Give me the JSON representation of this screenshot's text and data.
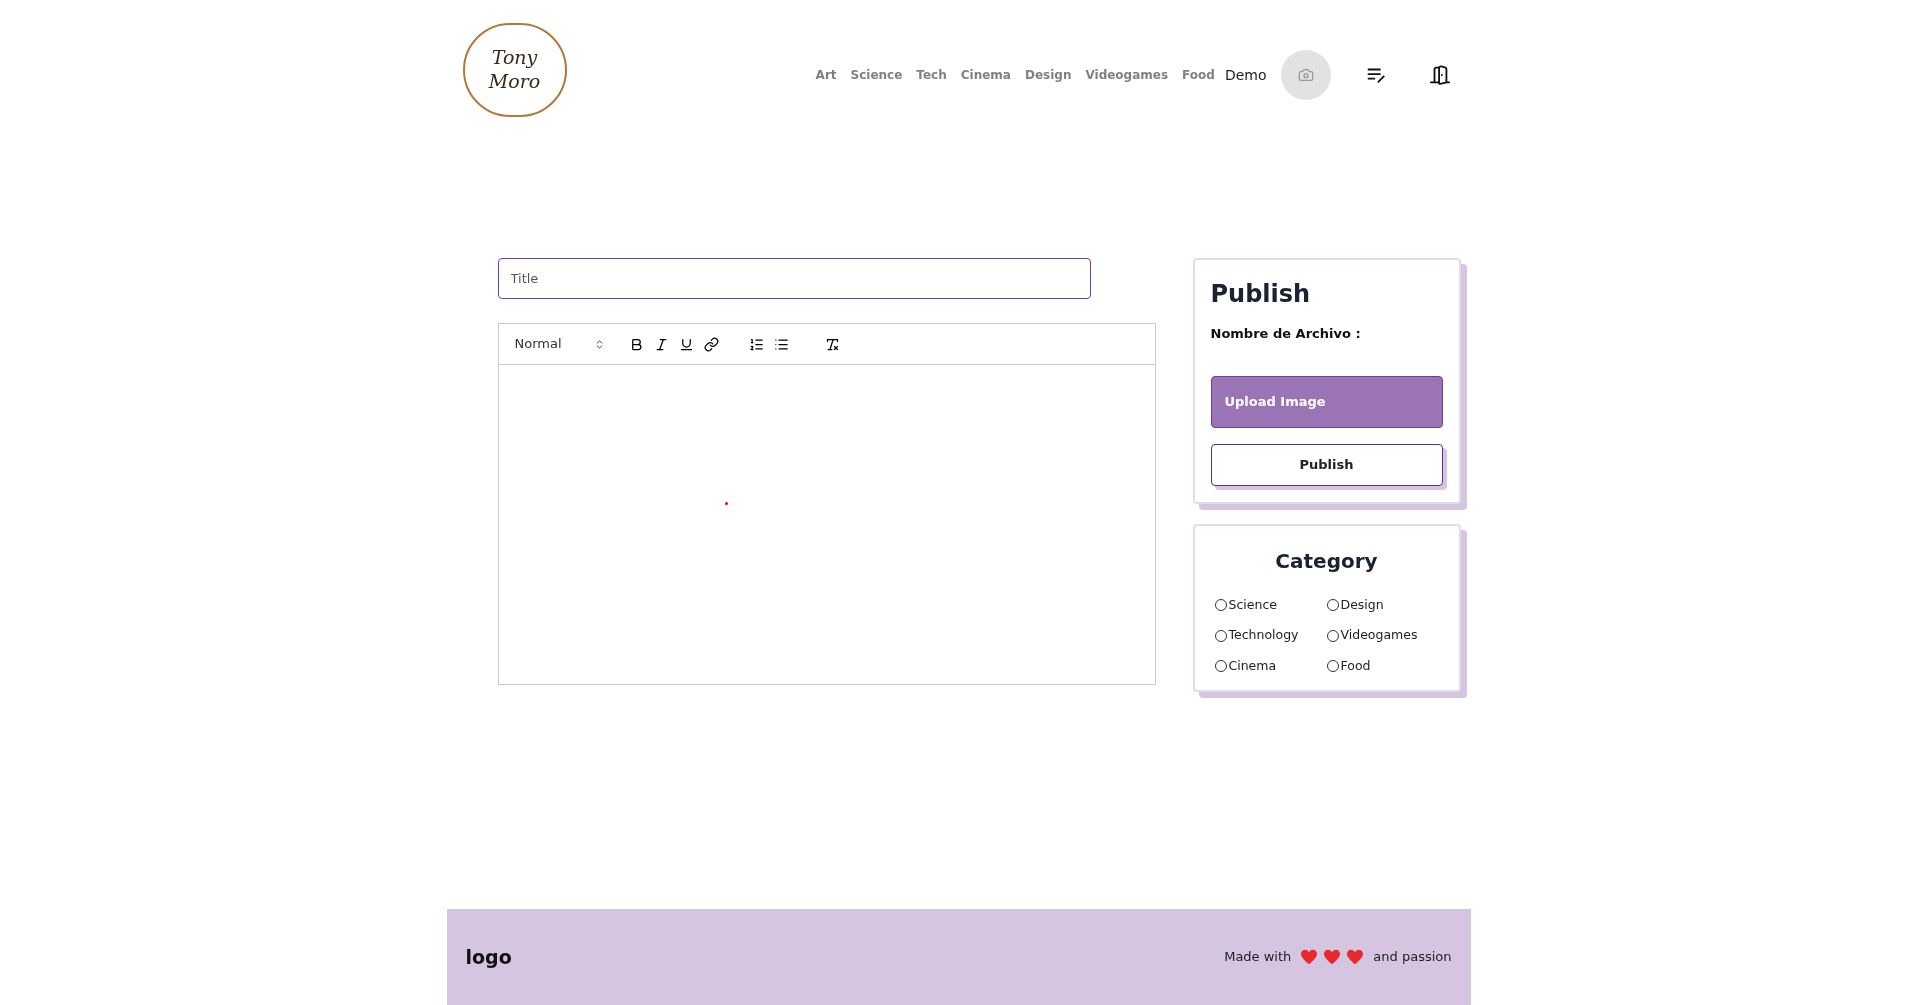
{
  "header": {
    "logo": "Tony Moro",
    "nav": [
      {
        "label": "Art"
      },
      {
        "label": "Science"
      },
      {
        "label": "Tech"
      },
      {
        "label": "Cinema"
      },
      {
        "label": "Design"
      },
      {
        "label": "Videogames"
      },
      {
        "label": "Food"
      }
    ],
    "user": "Demo"
  },
  "editor": {
    "title_placeholder": "Title",
    "format": "Normal"
  },
  "publish": {
    "heading": "Publish",
    "file_label": "Nombre de Archivo :",
    "upload_button": "Upload Image",
    "publish_button": "Publish"
  },
  "category": {
    "heading": "Category",
    "options": [
      {
        "label": "Science",
        "selected": false
      },
      {
        "label": "Design",
        "selected": false
      },
      {
        "label": "Technology",
        "selected": false
      },
      {
        "label": "Videogames",
        "selected": false
      },
      {
        "label": "Cinema",
        "selected": false
      },
      {
        "label": "Food",
        "selected": false
      }
    ]
  },
  "footer": {
    "logo": "logo",
    "made_with": "Made with",
    "and_passion": "and passion"
  }
}
